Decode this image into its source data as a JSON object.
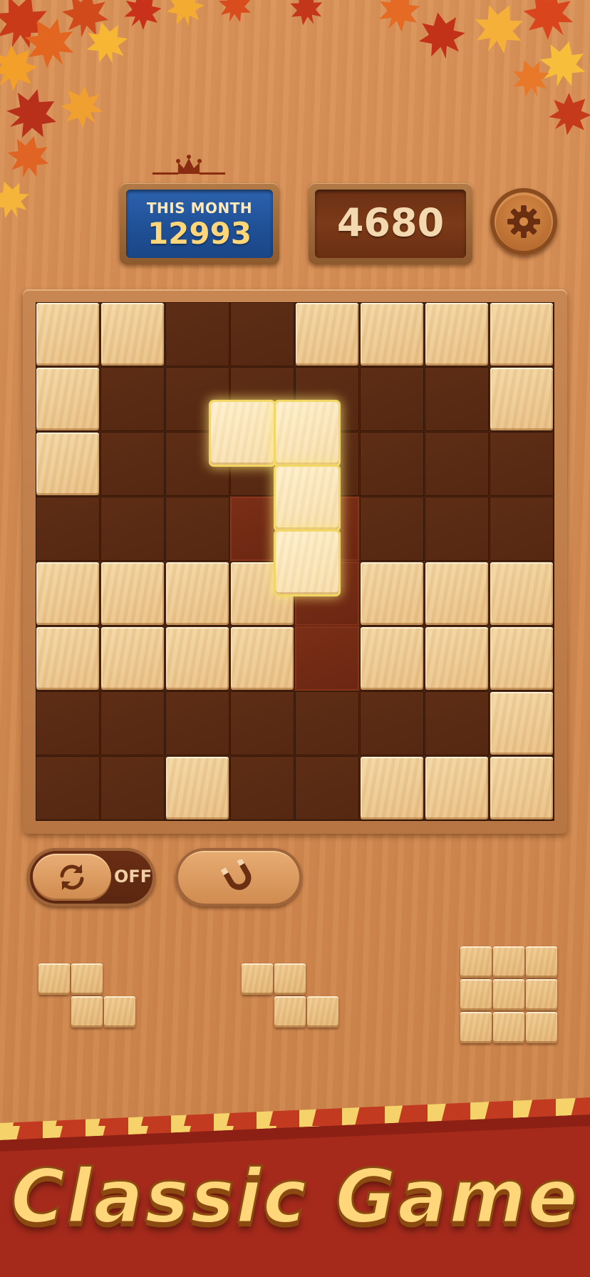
{
  "header": {
    "month_label": "THIS MONTH",
    "month_score": "12993",
    "current_score": "4680"
  },
  "controls": {
    "rotate_state": "OFF"
  },
  "board": {
    "rows": 8,
    "cols": 8,
    "cells": [
      "XX..XXXX",
      "X......X",
      "X.......",
      "...PP...",
      "XXXXPXXX",
      "XXXXPXXX",
      ".......X",
      "..X..XXX"
    ],
    "legend": {
      "X": "filled",
      ".": "empty",
      "P": "placement-preview"
    },
    "dragging_piece_cells": [
      [
        2,
        3
      ],
      [
        2,
        4
      ],
      [
        3,
        4
      ],
      [
        4,
        4
      ]
    ]
  },
  "tray": {
    "pieces": [
      {
        "name": "z-piece-1",
        "cells": [
          [
            0,
            0
          ],
          [
            0,
            1
          ],
          [
            1,
            1
          ],
          [
            1,
            2
          ]
        ]
      },
      {
        "name": "z-piece-2",
        "cells": [
          [
            0,
            0
          ],
          [
            0,
            1
          ],
          [
            1,
            1
          ],
          [
            1,
            2
          ]
        ]
      },
      {
        "name": "square-3x3",
        "cells": [
          [
            0,
            0
          ],
          [
            0,
            1
          ],
          [
            0,
            2
          ],
          [
            1,
            0
          ],
          [
            1,
            1
          ],
          [
            1,
            2
          ],
          [
            2,
            0
          ],
          [
            2,
            1
          ],
          [
            2,
            2
          ]
        ]
      }
    ]
  },
  "banner": {
    "title": "Classic Game"
  },
  "colors": {
    "background_wood": "#d38b52",
    "month_panel": "#1f4f95",
    "score_panel": "#6c3014",
    "block_light": "#f4d8a4",
    "board_dark": "#552812",
    "banner_red": "#a52a1c",
    "title_gold": "#ffd77a"
  },
  "icons": {
    "crown": "crown-icon",
    "settings": "gear-icon",
    "rotate": "rotate-icon",
    "magnet": "magnet-icon"
  }
}
